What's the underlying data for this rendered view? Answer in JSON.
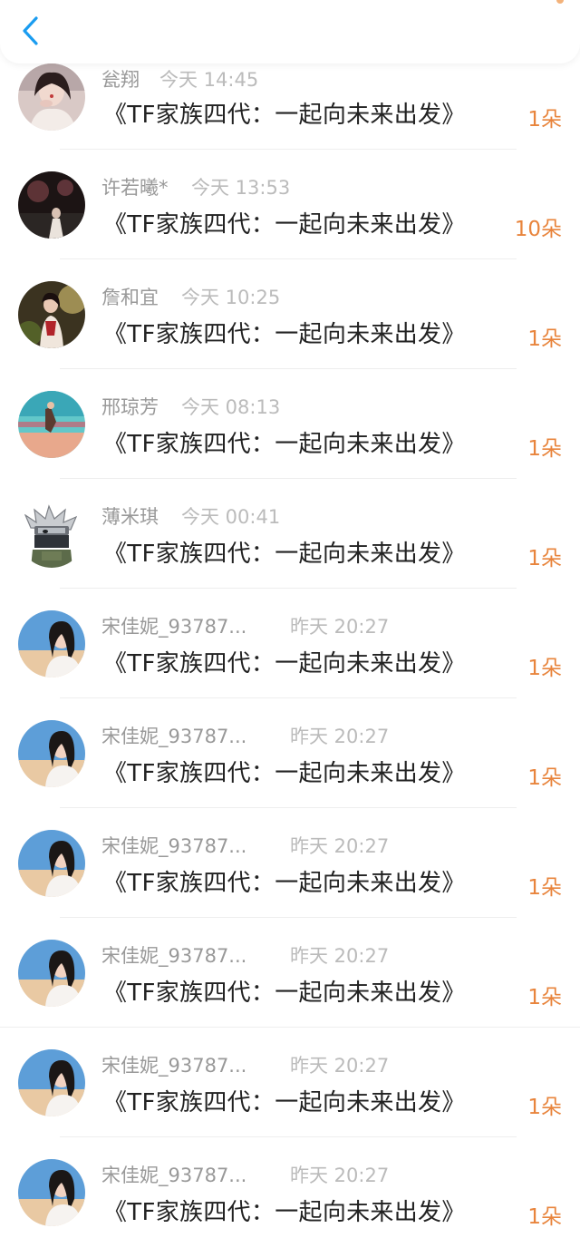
{
  "header": {
    "back_icon": "chevron-left-icon",
    "accent": "#1a9cf0"
  },
  "colors": {
    "name": "#999999",
    "time": "#bbbbbb",
    "title": "#222222",
    "count": "#e8843c"
  },
  "list": [
    {
      "name": "瓮翔",
      "time": "今天 14:45",
      "title": "《TF家族四代：一起向未来出发》",
      "count": "1朵",
      "avatar": "avatar-portrait-red"
    },
    {
      "name": "许若曦*",
      "time": "今天 13:53",
      "title": "《TF家族四代：一起向未来出发》",
      "count": "10朵",
      "avatar": "avatar-dark-scene"
    },
    {
      "name": "詹和宜",
      "time": "今天 10:25",
      "title": "《TF家族四代：一起向未来出发》",
      "count": "1朵",
      "avatar": "avatar-green-scene"
    },
    {
      "name": "邢琼芳",
      "time": "今天 08:13",
      "title": "《TF家族四代：一起向未来出发》",
      "count": "1朵",
      "avatar": "avatar-beach"
    },
    {
      "name": "薄米琪",
      "time": "今天 00:41",
      "title": "《TF家族四代：一起向未来出发》",
      "count": "1朵",
      "avatar": "avatar-ninja"
    },
    {
      "name": "宋佳妮_93787...",
      "time": "昨天 20:27",
      "title": "《TF家族四代：一起向未来出发》",
      "count": "1朵",
      "avatar": "avatar-girl-sky"
    },
    {
      "name": "宋佳妮_93787...",
      "time": "昨天 20:27",
      "title": "《TF家族四代：一起向未来出发》",
      "count": "1朵",
      "avatar": "avatar-girl-sky"
    },
    {
      "name": "宋佳妮_93787...",
      "time": "昨天 20:27",
      "title": "《TF家族四代：一起向未来出发》",
      "count": "1朵",
      "avatar": "avatar-girl-sky"
    },
    {
      "name": "宋佳妮_93787...",
      "time": "昨天 20:27",
      "title": "《TF家族四代：一起向未来出发》",
      "count": "1朵",
      "avatar": "avatar-girl-sky"
    },
    {
      "name": "宋佳妮_93787...",
      "time": "昨天 20:27",
      "title": "《TF家族四代：一起向未来出发》",
      "count": "1朵",
      "avatar": "avatar-girl-sky"
    },
    {
      "name": "宋佳妮_93787...",
      "time": "昨天 20:27",
      "title": "《TF家族四代：一起向未来出发》",
      "count": "1朵",
      "avatar": "avatar-girl-sky"
    }
  ]
}
